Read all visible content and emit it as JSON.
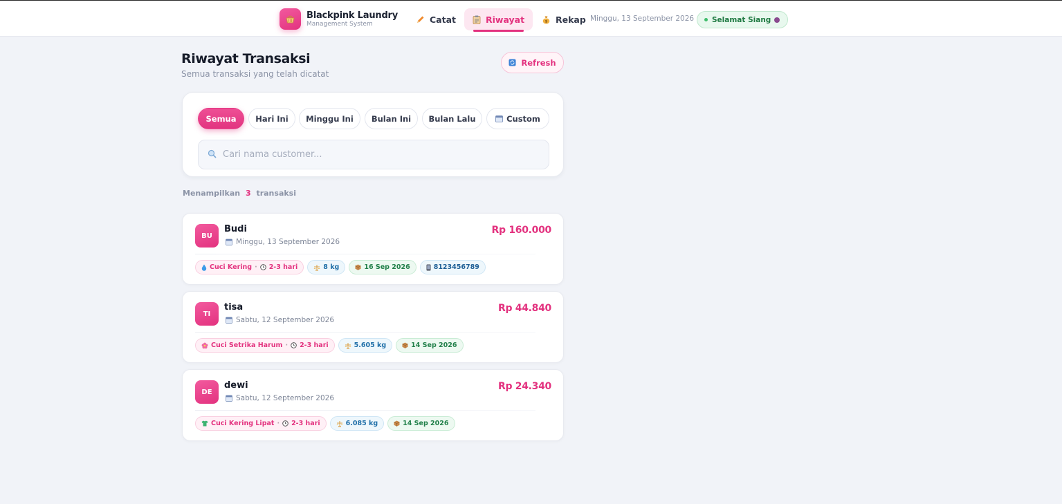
{
  "app": {
    "title": "Blackpink Laundry",
    "subtitle": "Management System"
  },
  "nav": {
    "catat": "Catat",
    "riwayat": "Riwayat",
    "rekap": "Rekap"
  },
  "header": {
    "date": "Minggu, 13 September 2026",
    "greeting": "Selamat Siang"
  },
  "page": {
    "title": "Riwayat Transaksi",
    "subtitle": "Semua transaksi yang telah dicatat",
    "refresh_label": "Refresh"
  },
  "filters": {
    "items": [
      "Semua",
      "Hari Ini",
      "Minggu Ini",
      "Bulan Ini",
      "Bulan Lalu",
      "Custom"
    ],
    "active": "Semua",
    "search_placeholder": "Cari nama customer...",
    "search_value": ""
  },
  "summary": {
    "prefix": "Menampilkan",
    "count": "3",
    "suffix": "transaksi"
  },
  "transactions": [
    {
      "initials": "BU",
      "name": "Budi",
      "date": "Minggu, 13 September 2026",
      "amount": "Rp 160.000",
      "service": "Cuci Kering",
      "service_icon": "water-drop-icon",
      "duration": "2-3 hari",
      "weight": "8 kg",
      "pickup": "16 Sep 2026",
      "phone": "8123456789"
    },
    {
      "initials": "TI",
      "name": "tisa",
      "date": "Sabtu, 12 September 2026",
      "amount": "Rp 44.840",
      "service": "Cuci Setrika Harum",
      "service_icon": "flower-icon",
      "duration": "2-3 hari",
      "weight": "5.605 kg",
      "pickup": "14 Sep 2026"
    },
    {
      "initials": "DE",
      "name": "dewi",
      "date": "Sabtu, 12 September 2026",
      "amount": "Rp 24.340",
      "service": "Cuci Kering Lipat",
      "service_icon": "shirt-icon",
      "duration": "2-3 hari",
      "weight": "6.085 kg",
      "pickup": "14 Sep 2026"
    }
  ],
  "colors": {
    "accent": "#e3327f",
    "background": "#f1f3f8",
    "success": "#22804a",
    "info": "#1f6fa8"
  }
}
